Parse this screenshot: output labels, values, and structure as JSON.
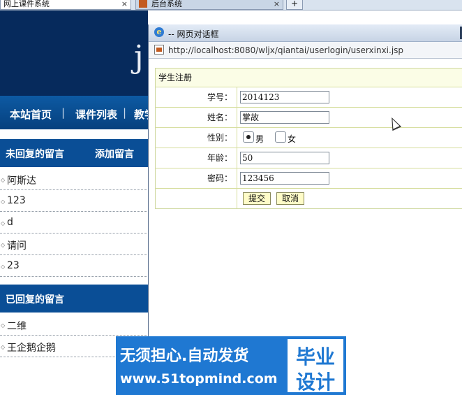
{
  "browser": {
    "tabs": [
      {
        "label": "网上课件系统",
        "close": "×"
      },
      {
        "label": "后台系统",
        "close": "×"
      }
    ],
    "new_tab": "+"
  },
  "site": {
    "header_letter": "j",
    "nav": [
      "本站首页",
      "课件列表",
      "教学"
    ],
    "nav_sep": "|",
    "unreplied": {
      "title": "未回复的留言",
      "add_link": "添加留言",
      "items": [
        "阿斯达",
        "123",
        "d",
        "请问",
        "23"
      ]
    },
    "replied": {
      "title": "已回复的留言",
      "items": [
        "二维",
        "王企鹅企鹅"
      ]
    }
  },
  "dialog": {
    "title": "-- 网页对话框",
    "url": "http://localhost:8080/wljx/qiantai/userlogin/userxinxi.jsp",
    "form": {
      "caption": "学生注册",
      "fields": [
        {
          "label": "学号：",
          "value": "2014123"
        },
        {
          "label": "姓名：",
          "value": "掌故"
        },
        {
          "label": "性别：",
          "options": [
            "男",
            "女"
          ],
          "selected": "男"
        },
        {
          "label": "年龄：",
          "value": "50"
        },
        {
          "label": "密码：",
          "value": "123456"
        }
      ],
      "submit": "提交",
      "cancel": "取消"
    }
  },
  "watermark": {
    "line1": "无须担心.自动发货",
    "line2": "www.51topmind.com",
    "badge1": "毕业",
    "badge2": "设计"
  }
}
